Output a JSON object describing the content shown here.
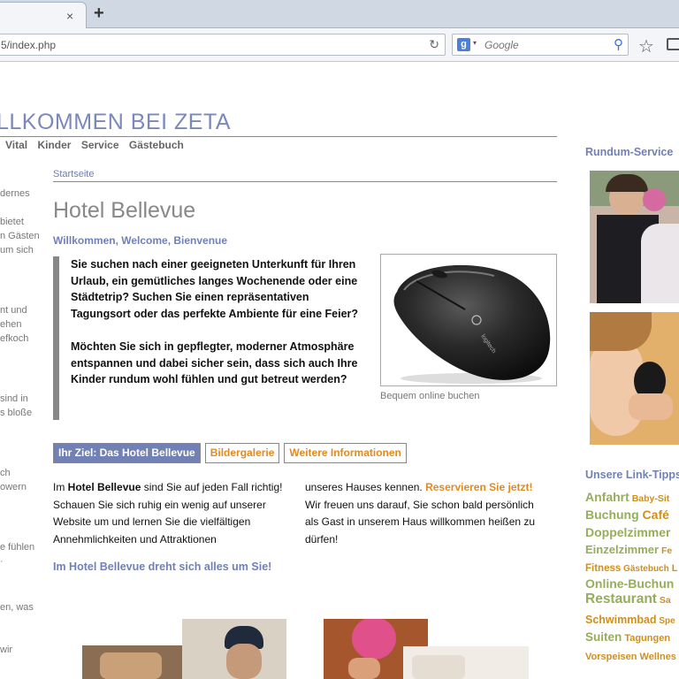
{
  "browser": {
    "tab_close": "×",
    "new_tab": "+",
    "url": "5/index.php",
    "search_engine_glyph": "g",
    "search_placeholder": "Google",
    "icons": [
      "close-icon",
      "plus-icon",
      "reload-icon",
      "google-icon",
      "search-icon",
      "bookmark-star-icon",
      "reading-list-icon"
    ]
  },
  "site": {
    "title": "LLKOMMEN BEI ZETA",
    "nav": [
      "Vital",
      "Kinder",
      "Service",
      "Gästebuch"
    ],
    "left_fragments": [
      "dernes",
      "bietet",
      "n Gästen",
      "um sich",
      "nt und",
      "ehen",
      "efkoch",
      "sind in",
      "s bloße",
      "ch",
      "owern",
      "e fühlen",
      "·",
      "en, was",
      "wir"
    ]
  },
  "main": {
    "breadcrumb": "Startseite",
    "heading": "Hotel Bellevue",
    "welcome": "Willkommen, Welcome, Bienvenue",
    "quote_p1": "Sie suchen nach einer geeigneten Unterkunft für Ihren Urlaub, ein gemütliches langes Wochenende oder eine Städtetrip? Suchen Sie einen repräsentativen Tagungsort oder das perfekte Ambiente für eine Feier?",
    "quote_p2": "Möchten Sie sich in gepflegter, moderner Atmosphäre entspannen und dabei sicher sein, dass sich auch Ihre Kinder rundum wohl fühlen und gut betreut werden?",
    "image_brand": "logitech",
    "image_caption": "Bequem online buchen",
    "tabs": [
      "Ihr Ziel: Das Hotel Bellevue",
      "Bildergalerie",
      "Weitere Informationen"
    ],
    "col1_prefix": "Im ",
    "col1_bold": "Hotel Bellevue",
    "col1_rest": " sind Sie auf jeden Fall richtig! Schauen Sie sich ruhig ein wenig auf unserer Website um und lernen Sie die vielfältigen Annehmlichkeiten und Attraktionen",
    "col2_start": "unseres Hauses kennen. ",
    "col2_link": "Reservieren Sie jetzt!",
    "col2_rest": " Wir freuen uns darauf, Sie schon bald persönlich als Gast in unserem Haus willkommen heißen zu dürfen!",
    "slogan": "Im Hotel Bellevue dreht sich alles um Sie!"
  },
  "sidebar": {
    "service_title": "Rundum-Service",
    "link_tips_title": "Unsere Link-Tipps",
    "tags": [
      [
        {
          "t": "Anfahrt",
          "c": "g",
          "s": 14
        },
        {
          "t": " Baby-Sit",
          "c": "o",
          "s": 10.5
        }
      ],
      [
        {
          "t": "Buchung",
          "c": "g",
          "s": 14
        },
        {
          "t": " Café",
          "c": "o",
          "s": 14
        }
      ],
      [
        {
          "t": "Doppelzimmer",
          "c": "g",
          "s": 14
        }
      ],
      [
        {
          "t": "Einzelzimmer",
          "c": "g",
          "s": 13
        },
        {
          "t": " Fe",
          "c": "o",
          "s": 10.5
        }
      ],
      [
        {
          "t": "Fitness",
          "c": "o",
          "s": 11.5
        },
        {
          "t": " Gästebuch",
          "c": "o",
          "s": 10
        },
        {
          "t": " L",
          "c": "o",
          "s": 11
        }
      ],
      [
        {
          "t": "Online-Buchun",
          "c": "g",
          "s": 14
        }
      ],
      [
        {
          "t": "Restaurant",
          "c": "g",
          "s": 15.5
        },
        {
          "t": " Sa",
          "c": "o",
          "s": 10.5
        }
      ],
      [
        {
          "t": "Schwimmbad",
          "c": "o",
          "s": 12.5
        },
        {
          "t": " Spe",
          "c": "o",
          "s": 10
        }
      ],
      [
        {
          "t": "Suiten",
          "c": "g",
          "s": 13.5
        },
        {
          "t": " Tagungen",
          "c": "o",
          "s": 11
        }
      ],
      [
        {
          "t": "Vorspeisen",
          "c": "o",
          "s": 11
        },
        {
          "t": " Wellnes",
          "c": "o",
          "s": 11
        }
      ]
    ]
  }
}
